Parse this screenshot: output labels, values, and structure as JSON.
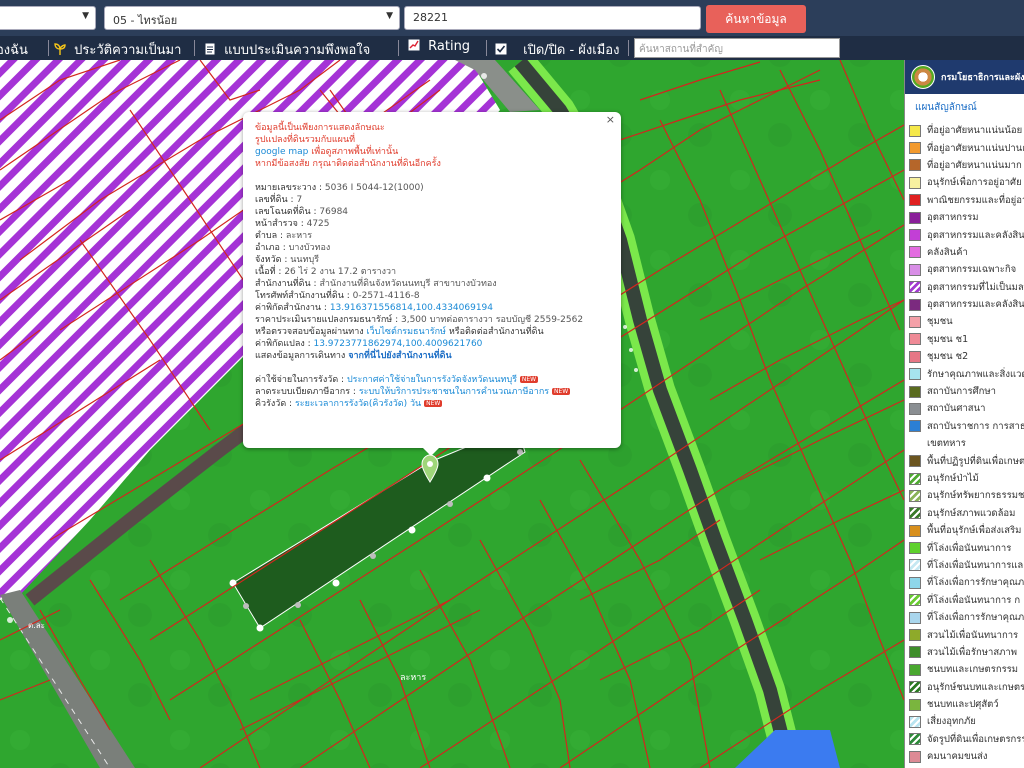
{
  "toolbar": {
    "province_value": "",
    "district_value": "05 - ไทรน้อย",
    "parcel_value": "28221",
    "search_button": "ค้นหาข้อมูล"
  },
  "menu": {
    "item_mine": "องฉัน",
    "item_history": "ประวัติความเป็นมา",
    "item_survey": "แบบประเมินความพึงพอใจ",
    "item_rating": "Rating",
    "item_toggle": "เปิด/ปิด - ผังเมือง",
    "place_placeholder": "ค้นหาสถานที่สำคัญ"
  },
  "popup": {
    "warn1": "ข้อมูลนี้เป็นเพียงการแสดงลักษณะ",
    "warn2": "รูปแปลงที่ดินรวมกับแผนที่",
    "warn3a": "google map",
    "warn3b": " เพื่อดูสภาพพื้นที่เท่านั้น",
    "warn4": "หากมีข้อสงสัย กรุณาติดต่อสำนักงานที่ดินอีกครั้ง",
    "sheet_label": "หมายเลขระวาง : ",
    "sheet_value": "5036 I 5044-12(1000)",
    "lot_label": "เลขที่ดิน : ",
    "lot_value": "7",
    "deed_label": "เลขโฉนดที่ดิน : ",
    "deed_value": "76984",
    "survey_label": "หน้าสำรวจ : ",
    "survey_value": "4725",
    "subdistrict_label": "ตำบล : ",
    "subdistrict_value": "ละหาร",
    "district_label": "อำเภอ : ",
    "district_value": "บางบัวทอง",
    "province_label": "จังหวัด : ",
    "province_value": "นนทบุรี",
    "area_label": "เนื้อที่ : ",
    "area_value": "26 ไร่ 2 งาน 17.2 ตารางวา",
    "office_label": "สำนักงานที่ดิน : ",
    "office_value": "สำนักงานที่ดินจังหวัดนนทบุรี สาขาบางบัวทอง",
    "phone_label": "โทรศัพท์สำนักงานที่ดิน : ",
    "phone_value": "0-2571-4116-8",
    "office_coord_label": "ค่าพิกัดสำนักงาน : ",
    "office_coord_value": "13.916371556814,100.4334069194",
    "price_label": "ราคาประเมินรายแปลงกรมธนารักษ์ : ",
    "price_value": "3,500 บาทต่อตารางวา รอบบัญชี 2559-2562",
    "verify_text": "หรือตรวจสอบข้อมูลผ่านทาง ",
    "verify_link": "เว็บไซต์กรมธนารักษ์",
    "verify_tail": " หรือติดต่อสำนักงานที่ดิน",
    "parcel_coord_label": "ค่าพิกัดแปลง : ",
    "parcel_coord_value": "13.9723771862974,100.4009621760",
    "route_label": "แสดงข้อมูลการเดินทาง ",
    "route_link": "จากที่นี่ไปยังสำนักงานที่ดิน",
    "fee_label": "ค่าใช้จ่ายในการรังวัด : ",
    "fee_link": "ประกาศค่าใช้จ่ายในการรังวัดจังหวัดนนทบุรี",
    "queue_label": "ลาดระบบเบียดภาษีอากร : ",
    "queue_link": "ระบบให้บริการประชาชนในการคำนวณภาษีอากร",
    "wait_label": "คิวรังวัด : ",
    "wait_link": "ระยะเวลาการรังวัด(คิวรังวัด) วัน",
    "new_badge": "NEW",
    "close": "×"
  },
  "map": {
    "label_bottom": "ละหาร",
    "label_left": "ต.ละ"
  },
  "sidebar": {
    "header": "กรมโยธาธิการและผังเมือง",
    "subtitle": "แผนสัญลักษณ์",
    "legend": [
      {
        "label": "ที่อยู่อาศัยหนาแน่นน้อย",
        "color": "#f5e84a",
        "pattern": "solid"
      },
      {
        "label": "ที่อยู่อาศัยหนาแน่นปานกลาง",
        "color": "#f29a2e",
        "pattern": "solid"
      },
      {
        "label": "ที่อยู่อาศัยหนาแน่นมาก",
        "color": "#b5662a",
        "pattern": "solid"
      },
      {
        "label": "อนุรักษ์เพื่อการอยู่อาศัย",
        "color": "#f7f0a0",
        "pattern": "solid"
      },
      {
        "label": "พาณิชยกรรมและที่อยู่อาศัย",
        "color": "#e02020",
        "pattern": "solid"
      },
      {
        "label": "อุตสาหกรรม",
        "color": "#8a1f9a",
        "pattern": "solid"
      },
      {
        "label": "อุตสาหกรรมและคลังสินค้า",
        "color": "#c23fd6",
        "pattern": "solid"
      },
      {
        "label": "คลังสินค้า",
        "color": "#e36be0",
        "pattern": "solid"
      },
      {
        "label": "อุตสาหกรรมเฉพาะกิจ",
        "color": "#d88ee6",
        "pattern": "solid"
      },
      {
        "label": "อุตสาหกรรมที่ไม่เป็นมลพิษ",
        "color": "#a33bd0",
        "pattern": "hatch"
      },
      {
        "label": "อุตสาหกรรมและคลังสินค้า",
        "color": "#7b2a7f",
        "pattern": "solid"
      },
      {
        "label": "ชุมชน",
        "color": "#f4a0a8",
        "pattern": "solid"
      },
      {
        "label": "ชุมชน ช1",
        "color": "#ef8a96",
        "pattern": "solid"
      },
      {
        "label": "ชุมชน ช2",
        "color": "#e67786",
        "pattern": "solid"
      },
      {
        "label": "รักษาคุณภาพและสิ่งแวดล้อม",
        "color": "#a6e3ef",
        "pattern": "solid"
      },
      {
        "label": "สถาบันการศึกษา",
        "color": "#5a6b1f",
        "pattern": "solid"
      },
      {
        "label": "สถาบันศาสนา",
        "color": "#8a8e92",
        "pattern": "solid"
      },
      {
        "label": "สถาบันราชการ การสาธารณูปโภค",
        "color": "#2b7fd4",
        "pattern": "solid"
      },
      {
        "label": "เขตทหาร",
        "color": "#ffffff",
        "pattern": "none"
      },
      {
        "label": "พื้นที่ปฏิรูปที่ดินเพื่อเกษตรกรรม",
        "color": "#6b5520",
        "pattern": "solid"
      },
      {
        "label": "อนุรักษ์ป่าไม้",
        "color": "#4faa32",
        "pattern": "hatch"
      },
      {
        "label": "อนุรักษ์ทรัพยากรธรรมชาติ",
        "color": "#8bb35a",
        "pattern": "hatch"
      },
      {
        "label": "อนุรักษ์สภาพแวดล้อม",
        "color": "#3a7b2a",
        "pattern": "hatch"
      },
      {
        "label": "พื้นที่อนุรักษ์เพื่อส่งเสริม",
        "color": "#d88f1c",
        "pattern": "solid"
      },
      {
        "label": "ที่โล่งเพื่อนันทนาการ",
        "color": "#5ed12c",
        "pattern": "solid"
      },
      {
        "label": "ที่โล่งเพื่อนันทนาการและ",
        "color": "#c5e8f2",
        "pattern": "hatch"
      },
      {
        "label": "ที่โล่งเพื่อการรักษาคุณภาพ",
        "color": "#8ed6ea",
        "pattern": "solid"
      },
      {
        "label": "ที่โล่งเพื่อนันทนาการ ก",
        "color": "#6acb33",
        "pattern": "hatch"
      },
      {
        "label": "ที่โล่งเพื่อการรักษาคุณภาพ",
        "color": "#a9d6ed",
        "pattern": "solid"
      },
      {
        "label": "สวนไม้เพื่อนันทนาการ",
        "color": "#8eaa2a",
        "pattern": "solid"
      },
      {
        "label": "สวนไม้เพื่อรักษาสภาพ",
        "color": "#3e8e2a",
        "pattern": "solid"
      },
      {
        "label": "ชนบทและเกษตรกรรม",
        "color": "#49a82f",
        "pattern": "solid"
      },
      {
        "label": "อนุรักษ์ชนบทและเกษตรกรรม",
        "color": "#2b7a22",
        "pattern": "hatch"
      },
      {
        "label": "ชนบทและปศุสัตว์",
        "color": "#7ab53e",
        "pattern": "solid"
      },
      {
        "label": "เสี่ยงอุทกภัย",
        "color": "#b8e4f0",
        "pattern": "hatch"
      },
      {
        "label": "จัดรูปที่ดินเพื่อเกษตรกรรม",
        "color": "#2e8a3a",
        "pattern": "hatch"
      },
      {
        "label": "คมนาคมขนส่ง",
        "color": "#dd8a95",
        "pattern": "solid"
      }
    ]
  }
}
